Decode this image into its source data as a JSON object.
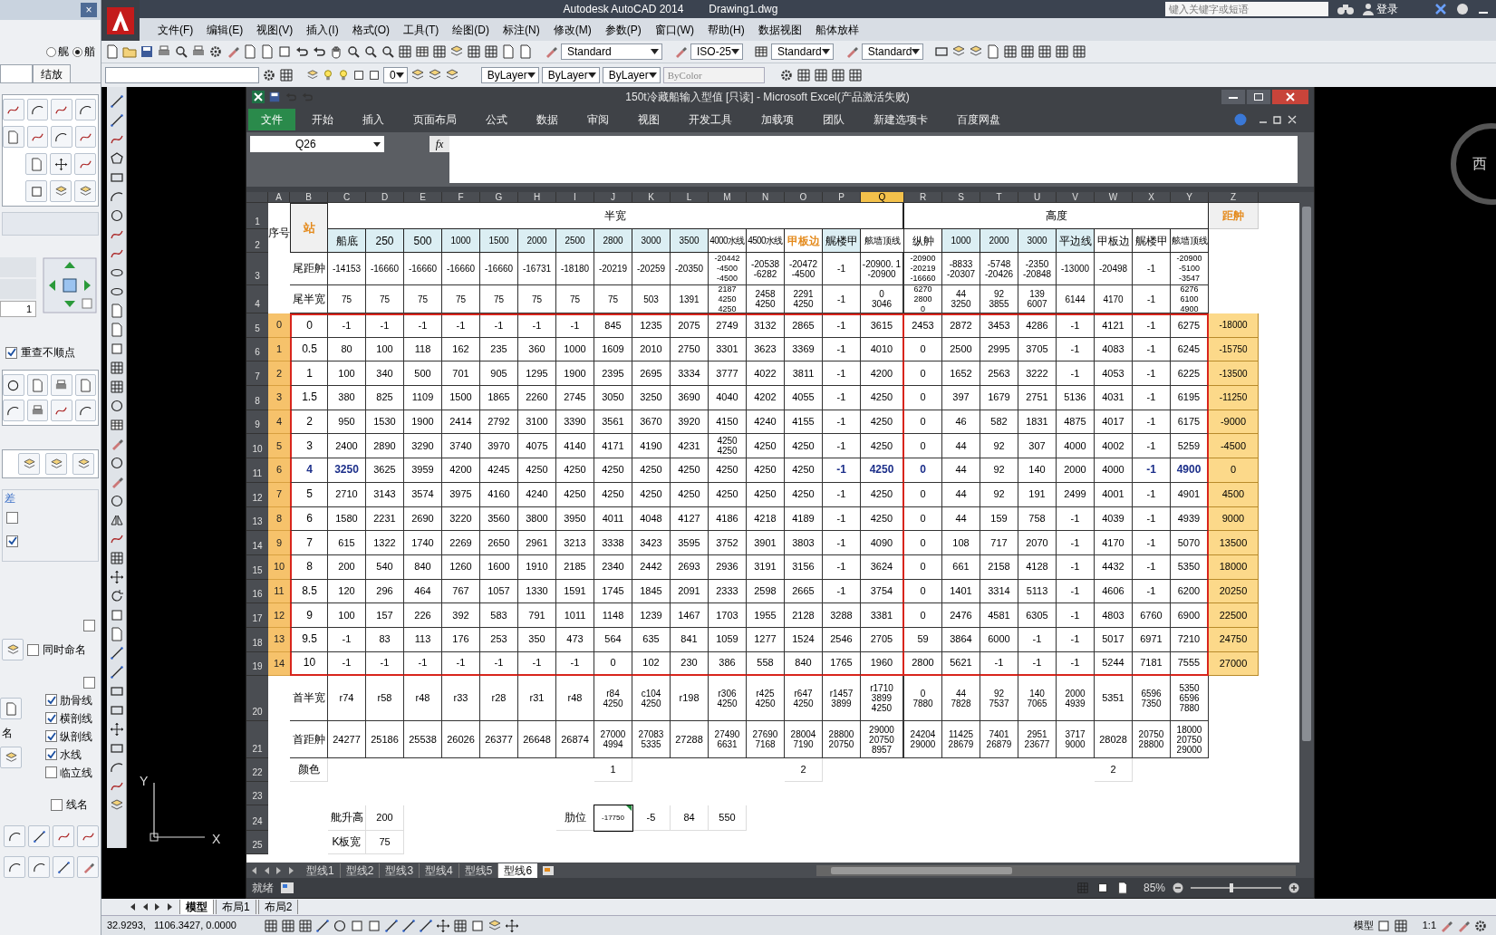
{
  "app": {
    "title": "Autodesk AutoCAD 2014",
    "document": "Drawing1.dwg",
    "search_placeholder": "键入关键字或短语",
    "sign_in": "登录"
  },
  "menu": [
    "文件(F)",
    "编辑(E)",
    "视图(V)",
    "插入(I)",
    "格式(O)",
    "工具(T)",
    "绘图(D)",
    "标注(N)",
    "修改(M)",
    "参数(P)",
    "窗口(W)",
    "帮助(H)",
    "数据视图",
    "船体放样"
  ],
  "toolbar": {
    "text_style": "Standard",
    "dim_style": "ISO-25",
    "table_style": "Standard",
    "multileader_style": "Standard"
  },
  "properties": {
    "layer": "0",
    "color_setting": "ByLayer",
    "linetype": "ByLayer",
    "lineweight": "ByLayer",
    "plot_style": "ByColor"
  },
  "palette": {
    "close": "×",
    "radios": [
      {
        "label": "艉",
        "selected": false
      },
      {
        "label": "艏",
        "selected": true
      }
    ],
    "tab": "结放",
    "spin_value": "1",
    "recheck": {
      "label": "重查不顺点",
      "checked": true
    },
    "tolerance_label": "差",
    "tolerance_checks": [
      {
        "checked": false
      },
      {
        "checked": true
      }
    ],
    "corner_checks": [
      {
        "checked": false
      },
      {
        "checked": false
      }
    ],
    "rename": {
      "label": "同时命名",
      "checked": false
    },
    "lines": [
      {
        "label": "肋骨线",
        "checked": true
      },
      {
        "label": "横剖线",
        "checked": true
      },
      {
        "label": "纵剖线",
        "checked": true
      },
      {
        "label": "水线",
        "checked": true
      },
      {
        "label": "临立线",
        "checked": false
      }
    ],
    "name_label": "名",
    "line_name": {
      "label": "线名",
      "checked": false
    }
  },
  "viewcube": {
    "label": "西"
  },
  "ucs": {
    "x_label": "X",
    "y_label": "Y"
  },
  "excel": {
    "title": "150t冷藏船输入型值  [只读]  - Microsoft Excel(产品激活失败)",
    "tabs": [
      {
        "label": "文件",
        "selected": true
      },
      {
        "label": "开始",
        "selected": false
      },
      {
        "label": "插入",
        "selected": false
      },
      {
        "label": "页面布局",
        "selected": false
      },
      {
        "label": "公式",
        "selected": false
      },
      {
        "label": "数据",
        "selected": false
      },
      {
        "label": "审阅",
        "selected": false
      },
      {
        "label": "视图",
        "selected": false
      },
      {
        "label": "开发工具",
        "selected": false
      },
      {
        "label": "加载项",
        "selected": false
      },
      {
        "label": "团队",
        "selected": false
      },
      {
        "label": "新建选项卡",
        "selected": false
      },
      {
        "label": "百度网盘",
        "selected": false
      }
    ],
    "name_box": "Q26",
    "function_label": "fx",
    "columns": [
      {
        "letter": "A",
        "selected": false
      },
      {
        "letter": "B",
        "selected": false
      },
      {
        "letter": "C",
        "selected": false
      },
      {
        "letter": "D",
        "selected": false
      },
      {
        "letter": "E",
        "selected": false
      },
      {
        "letter": "F",
        "selected": false
      },
      {
        "letter": "G",
        "selected": false
      },
      {
        "letter": "H",
        "selected": false
      },
      {
        "letter": "I",
        "selected": false
      },
      {
        "letter": "J",
        "selected": false
      },
      {
        "letter": "K",
        "selected": false
      },
      {
        "letter": "L",
        "selected": false
      },
      {
        "letter": "M",
        "selected": false
      },
      {
        "letter": "N",
        "selected": false
      },
      {
        "letter": "O",
        "selected": false
      },
      {
        "letter": "P",
        "selected": false
      },
      {
        "letter": "Q",
        "selected": true
      },
      {
        "letter": "R",
        "selected": false
      },
      {
        "letter": "S",
        "selected": false
      },
      {
        "letter": "T",
        "selected": false
      },
      {
        "letter": "U",
        "selected": false
      },
      {
        "letter": "V",
        "selected": false
      },
      {
        "letter": "W",
        "selected": false
      },
      {
        "letter": "X",
        "selected": false
      },
      {
        "letter": "Y",
        "selected": false
      },
      {
        "letter": "Z",
        "selected": false
      }
    ],
    "header": {
      "row_numbers": [
        "1",
        "2"
      ],
      "seq": "序号",
      "station": "站",
      "half_width": "半宽",
      "height": "高度",
      "mid_distance": "距舯",
      "labels": [
        {
          "text": "船底",
          "shaded": true,
          "emphasis": false
        },
        {
          "text": "250",
          "shaded": true,
          "emphasis": false
        },
        {
          "text": "500",
          "shaded": true,
          "emphasis": false
        },
        {
          "text": "1000",
          "shaded": true,
          "emphasis": false
        },
        {
          "text": "1500",
          "shaded": true,
          "emphasis": false
        },
        {
          "text": "2000",
          "shaded": true,
          "emphasis": false
        },
        {
          "text": "2500",
          "shaded": true,
          "emphasis": false
        },
        {
          "text": "2800",
          "shaded": true,
          "emphasis": false
        },
        {
          "text": "3000",
          "shaded": true,
          "emphasis": false
        },
        {
          "text": "3500",
          "shaded": true,
          "emphasis": false
        },
        {
          "text": "4000水线",
          "shaded": false,
          "emphasis": false
        },
        {
          "text": "4500水线",
          "shaded": false,
          "emphasis": false
        },
        {
          "text": "甲板边",
          "shaded": false,
          "emphasis": true
        },
        {
          "text": "艉楼甲",
          "shaded": true,
          "emphasis": false
        },
        {
          "text": "舷墙顶线",
          "shaded": false,
          "emphasis": false
        },
        {
          "text": "纵舯",
          "shaded": false,
          "emphasis": false
        },
        {
          "text": "1000",
          "shaded": true,
          "emphasis": false
        },
        {
          "text": "2000",
          "shaded": true,
          "emphasis": false
        },
        {
          "text": "3000",
          "shaded": true,
          "emphasis": false
        },
        {
          "text": "平边线",
          "shaded": true,
          "emphasis": false
        },
        {
          "text": "甲板边",
          "shaded": false,
          "emphasis": false
        },
        {
          "text": "艉楼甲",
          "shaded": false,
          "emphasis": false
        },
        {
          "text": "舷墙顶线",
          "shaded": false,
          "emphasis": false
        }
      ]
    },
    "rows": [
      {
        "number": "3",
        "framed": false,
        "cells": [
          "",
          "尾距舯",
          "-14153",
          "-16660",
          "-16660",
          "-16660",
          "-16660",
          "-16731",
          "-18180",
          "-20219",
          "-20259",
          "-20350",
          "-20442\n-4500\n-4500",
          "-20538\n-6282",
          "-20472\n-4500",
          "-1",
          "-20900. 1\n-20900",
          "-20900\n-20219\n-16660",
          "-8833\n-20307",
          "-5748\n-20426",
          "-2350\n-20848",
          "-13000",
          "-20498",
          "-1",
          "-20900\n-5100\n-3547",
          ""
        ]
      },
      {
        "number": "4",
        "framed": false,
        "cells": [
          "",
          "尾半宽",
          "75",
          "75",
          "75",
          "75",
          "75",
          "75",
          "75",
          "75",
          "503",
          "1391",
          "2187\n4250\n4250",
          "2458\n4250",
          "2291\n4250",
          "-1",
          "0\n3046",
          "6270\n2800\n0",
          "44\n3250",
          "92\n3855",
          "139\n6007",
          "6144",
          "4170",
          "-1",
          "6276\n6100\n4900",
          ""
        ]
      },
      {
        "number": "5",
        "framed": true,
        "cells": [
          "0",
          "0",
          "-1",
          "-1",
          "-1",
          "-1",
          "-1",
          "-1",
          "-1",
          "845",
          "1235",
          "2075",
          "2749",
          "3132",
          "2865",
          "-1",
          "3615",
          "2453",
          "2872",
          "3453",
          "4286",
          "-1",
          "4121",
          "-1",
          "6275",
          "-18000"
        ]
      },
      {
        "number": "6",
        "framed": true,
        "cells": [
          "1",
          "0.5",
          "80",
          "100",
          "118",
          "162",
          "235",
          "360",
          "1000",
          "1609",
          "2010",
          "2750",
          "3301",
          "3623",
          "3369",
          "-1",
          "4010",
          "0",
          "2500",
          "2995",
          "3705",
          "-1",
          "4083",
          "-1",
          "6245",
          "-15750"
        ]
      },
      {
        "number": "7",
        "framed": true,
        "cells": [
          "2",
          "1",
          "100",
          "340",
          "500",
          "701",
          "905",
          "1295",
          "1900",
          "2395",
          "2695",
          "3334",
          "3777",
          "4022",
          "3811",
          "-1",
          "4200",
          "0",
          "1652",
          "2563",
          "3222",
          "-1",
          "4053",
          "-1",
          "6225",
          "-13500"
        ]
      },
      {
        "number": "8",
        "framed": true,
        "cells": [
          "3",
          "1.5",
          "380",
          "825",
          "1109",
          "1500",
          "1865",
          "2260",
          "2745",
          "3050",
          "3250",
          "3690",
          "4040",
          "4202",
          "4055",
          "-1",
          "4250",
          "0",
          "397",
          "1679",
          "2751",
          "5136",
          "4031",
          "-1",
          "6195",
          "-11250"
        ]
      },
      {
        "number": "9",
        "framed": true,
        "cells": [
          "4",
          "2",
          "950",
          "1530",
          "1900",
          "2414",
          "2792",
          "3100",
          "3390",
          "3561",
          "3670",
          "3920",
          "4150",
          "4240",
          "4155",
          "-1",
          "4250",
          "0",
          "46",
          "582",
          "1831",
          "4875",
          "4017",
          "-1",
          "6175",
          "-9000"
        ]
      },
      {
        "number": "10",
        "framed": true,
        "cells": [
          "5",
          "3",
          "2400",
          "2890",
          "3290",
          "3740",
          "3970",
          "4075",
          "4140",
          "4171",
          "4190",
          "4231",
          "4250\n4250",
          "4250",
          "4250",
          "-1",
          "4250",
          "0",
          "44",
          "92",
          "307",
          "4000",
          "4002",
          "-1",
          "5259",
          "-4500"
        ]
      },
      {
        "number": "11",
        "framed": true,
        "cells": [
          "6",
          {
            "text": "4",
            "bold": true
          },
          {
            "text": "3250",
            "bold": true
          },
          "3625",
          "3959",
          "4200",
          "4245",
          "4250",
          "4250",
          "4250",
          "4250",
          "4250",
          "4250",
          "4250",
          "4250",
          {
            "text": "-1",
            "bold": true
          },
          {
            "text": "4250",
            "bold": true
          },
          {
            "text": "0",
            "bold": true
          },
          "44",
          "92",
          "140",
          "2000",
          "4000",
          {
            "text": "-1",
            "bold": true
          },
          {
            "text": "4900",
            "bold": true
          },
          "0"
        ]
      },
      {
        "number": "12",
        "framed": true,
        "cells": [
          "7",
          "5",
          "2710",
          "3143",
          "3574",
          "3975",
          "4160",
          "4240",
          "4250",
          "4250",
          "4250",
          "4250",
          "4250",
          "4250",
          "4250",
          "-1",
          "4250",
          "0",
          "44",
          "92",
          "191",
          "2499",
          "4001",
          "-1",
          "4901",
          "4500"
        ]
      },
      {
        "number": "13",
        "framed": true,
        "cells": [
          "8",
          "6",
          "1580",
          "2231",
          "2690",
          "3220",
          "3560",
          "3800",
          "3950",
          "4011",
          "4048",
          "4127",
          "4186",
          "4218",
          "4189",
          "-1",
          "4250",
          "0",
          "44",
          "159",
          "758",
          "-1",
          "4039",
          "-1",
          "4939",
          "9000"
        ]
      },
      {
        "number": "14",
        "framed": true,
        "cells": [
          "9",
          "7",
          "615",
          "1322",
          "1740",
          "2269",
          "2650",
          "2961",
          "3213",
          "3338",
          "3423",
          "3595",
          "3752",
          "3901",
          "3803",
          "-1",
          "4090",
          "0",
          "108",
          "717",
          "2070",
          "-1",
          "4170",
          "-1",
          "5070",
          "13500"
        ]
      },
      {
        "number": "15",
        "framed": true,
        "cells": [
          "10",
          "8",
          "200",
          "540",
          "840",
          "1260",
          "1600",
          "1910",
          "2185",
          "2340",
          "2442",
          "2693",
          "2936",
          "3191",
          "3156",
          "-1",
          "3624",
          "0",
          "661",
          "2158",
          "4128",
          "-1",
          "4432",
          "-1",
          "5350",
          "18000"
        ]
      },
      {
        "number": "16",
        "framed": true,
        "cells": [
          "11",
          "8.5",
          "120",
          "296",
          "464",
          "767",
          "1057",
          "1330",
          "1591",
          "1745",
          "1845",
          "2091",
          "2333",
          "2598",
          "2665",
          "-1",
          "3754",
          "0",
          "1401",
          "3314",
          "5113",
          "-1",
          "4606",
          "-1",
          "6200",
          "20250"
        ]
      },
      {
        "number": "17",
        "framed": true,
        "cells": [
          "12",
          "9",
          "100",
          "157",
          "226",
          "392",
          "583",
          "791",
          "1011",
          "1148",
          "1239",
          "1467",
          "1703",
          "1955",
          "2128",
          "3288",
          "3381",
          "0",
          "2476",
          "4581",
          "6305",
          "-1",
          "4803",
          "6760",
          "6900",
          "22500"
        ]
      },
      {
        "number": "18",
        "framed": true,
        "cells": [
          "13",
          "9.5",
          "-1",
          "83",
          "113",
          "176",
          "253",
          "350",
          "473",
          "564",
          "635",
          "841",
          "1059",
          "1277",
          "1524",
          "2546",
          "2705",
          "59",
          "3864",
          "6000",
          "-1",
          "-1",
          "5017",
          "6971",
          "7210",
          "24750"
        ]
      },
      {
        "number": "19",
        "framed": true,
        "cells": [
          "14",
          "10",
          "-1",
          "-1",
          "-1",
          "-1",
          "-1",
          "-1",
          "-1",
          "0",
          "102",
          "230",
          "386",
          "558",
          "840",
          "1765",
          "1960",
          "2800",
          "5621",
          "-1",
          "-1",
          "-1",
          "5244",
          "7181",
          "7555",
          "27000"
        ]
      },
      {
        "number": "20",
        "framed": false,
        "cells": [
          "",
          "首半宽",
          "r74",
          "r58",
          "r48",
          "r33",
          "r28",
          "r31",
          "r48",
          "r84\n4250",
          "c104\n4250",
          "r198",
          "r306\n4250",
          "r425\n4250",
          "r647\n4250",
          "r1457\n3899",
          "r1710\n3899\n4250",
          "0\n7880",
          "44\n7828",
          "92\n7537",
          "140\n7065",
          "2000\n4939",
          "5351",
          "6596\n7350",
          "5350\n6596\n7880",
          ""
        ]
      },
      {
        "number": "21",
        "framed": false,
        "cells": [
          "",
          "首距舯",
          "24277",
          "25186",
          "25538",
          "26026",
          "26377",
          "26648",
          "26874",
          "27000\n4994",
          "27083\n5335",
          "27288",
          "27490\n6631",
          "27690\n7168",
          "28004\n7190",
          "28800\n20750",
          "29000\n20750\n8957",
          "24204\n29000",
          "11425\n28679",
          "7401\n26879",
          "2951\n23677",
          "3717\n9000",
          "28028",
          "20750\n28800",
          "18000\n20750\n29000",
          ""
        ]
      },
      {
        "number": "22",
        "framed": false,
        "cells": [
          "",
          "颜色",
          "",
          "",
          "",
          "",
          "",
          "",
          "",
          "1",
          "",
          "",
          "",
          "",
          "2",
          "",
          "",
          "",
          "",
          "",
          "",
          "",
          "2",
          "",
          "",
          ""
        ]
      },
      {
        "number": "23",
        "framed": false,
        "cells": [
          "",
          "",
          "",
          "",
          "",
          "",
          "",
          "",
          "",
          "",
          "",
          "",
          "",
          "",
          "",
          "",
          "",
          "",
          "",
          "",
          "",
          "",
          "",
          "",
          "",
          ""
        ]
      },
      {
        "number": "24",
        "framed": false,
        "cells": [
          "",
          "",
          "舭升高",
          "200",
          "",
          "",
          "",
          "",
          "肋位",
          {
            "text": "-17750",
            "flagged": true
          },
          "-5",
          "84",
          "550",
          "",
          "",
          "",
          "",
          "",
          "",
          "",
          "",
          "",
          "",
          "",
          "",
          ""
        ]
      },
      {
        "number": "25",
        "framed": false,
        "cells": [
          "",
          "",
          "K板宽",
          "75",
          "",
          "",
          "",
          "",
          "",
          "",
          "",
          "",
          "",
          "",
          "",
          "",
          "",
          "",
          "",
          "",
          "",
          "",
          "",
          "",
          "",
          ""
        ]
      }
    ],
    "sheets": [
      {
        "label": "型线1",
        "selected": false
      },
      {
        "label": "型线2",
        "selected": false
      },
      {
        "label": "型线3",
        "selected": false
      },
      {
        "label": "型线4",
        "selected": false
      },
      {
        "label": "型线5",
        "selected": false
      },
      {
        "label": "型线6",
        "selected": true
      }
    ],
    "status": "就绪",
    "zoom": "85%",
    "zoom_slider": {
      "level": 0.45
    }
  },
  "layout_tabs": [
    {
      "label": "模型",
      "selected": true
    },
    {
      "label": "布局1",
      "selected": false
    },
    {
      "label": "布局2",
      "selected": false
    }
  ],
  "status_bar": {
    "coordinates": "32.9293,   1106.3427, 0.0000",
    "space": "模型",
    "scale": "1:1"
  }
}
